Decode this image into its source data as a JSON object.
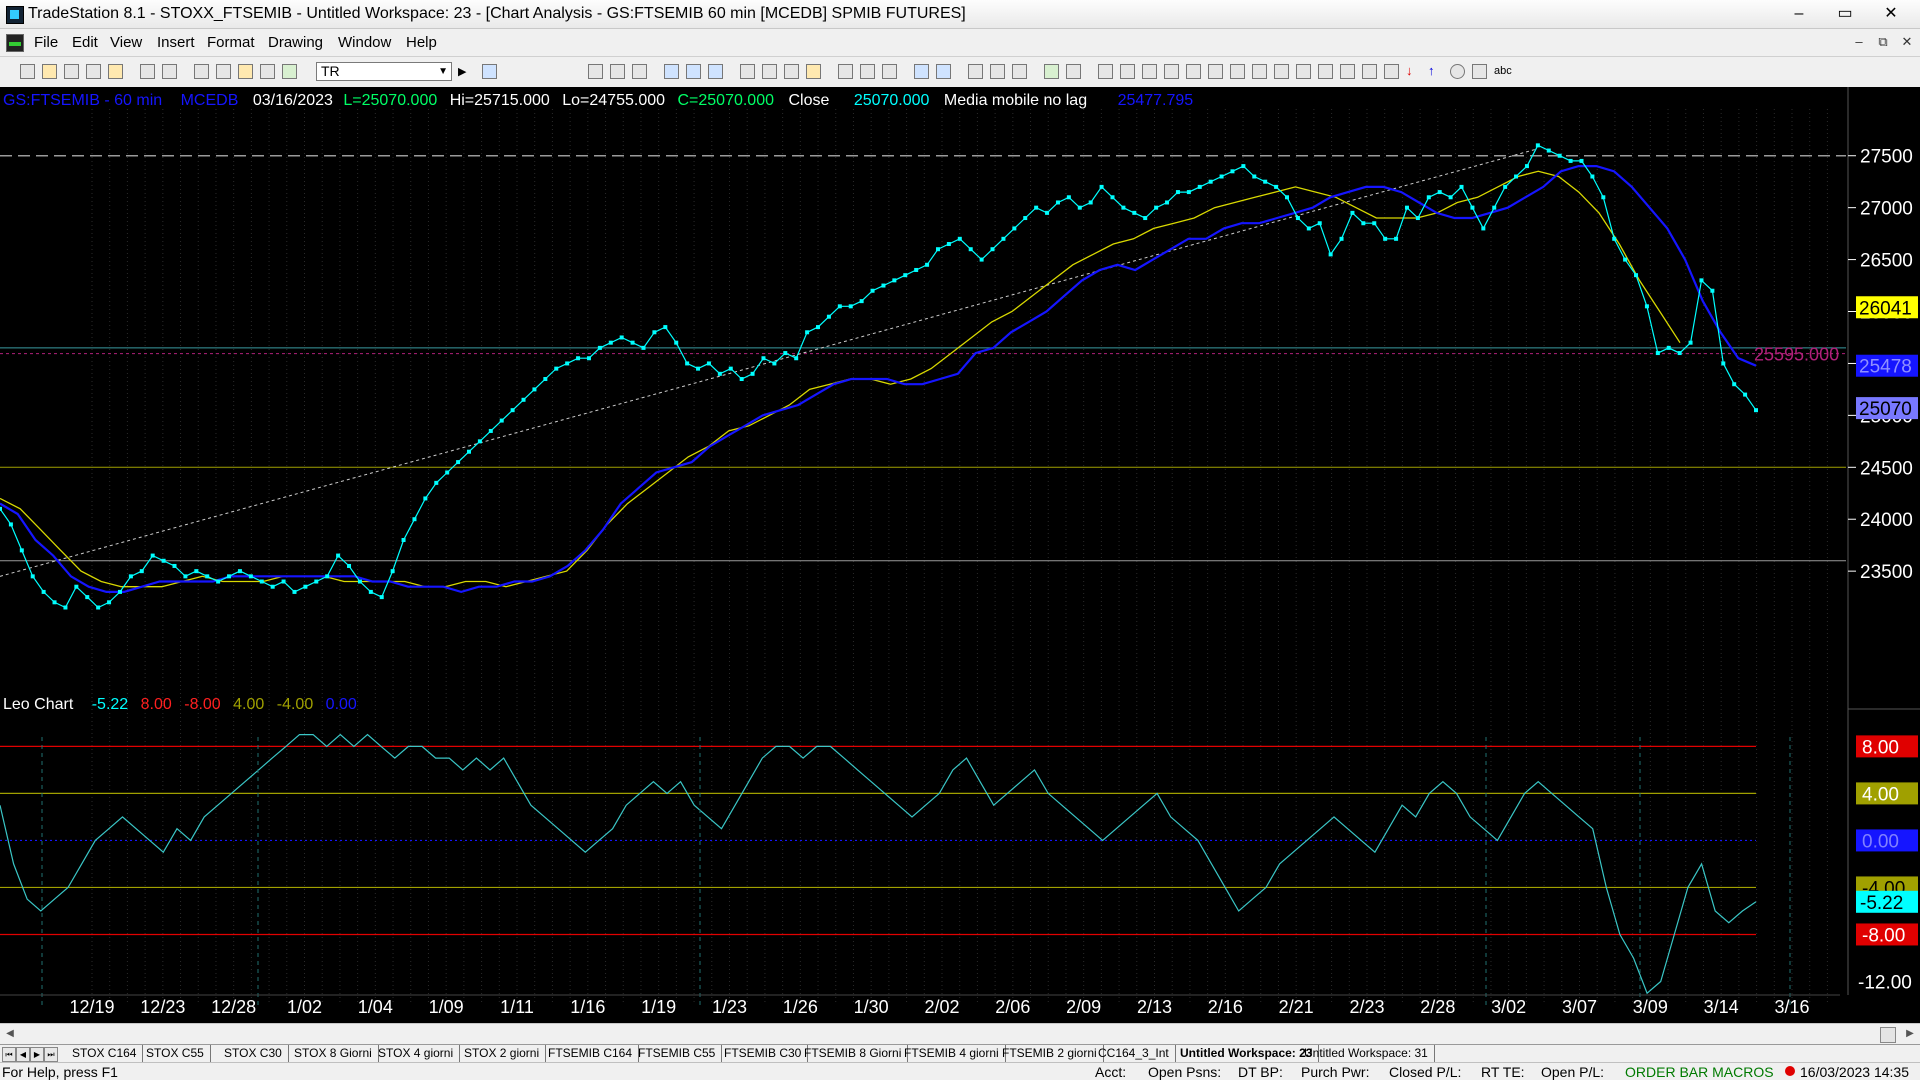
{
  "window": {
    "title": "TradeStation 8.1 - STOXX_FTSEMIB - Untitled Workspace:  23 - [Chart Analysis - GS:FTSEMIB  60 min  [MCEDB] SPMIB FUTURES]",
    "minimize": "–",
    "maximize": "▭",
    "close": "✕"
  },
  "menu": {
    "items": [
      "File",
      "Edit",
      "View",
      "Insert",
      "Format",
      "Drawing",
      "Window",
      "Help"
    ],
    "mdi_min": "–",
    "mdi_restore": "⧉",
    "mdi_close": "✕"
  },
  "toolbar": {
    "symbol_value": "TR",
    "tool_text": "abc"
  },
  "price_header": {
    "symbol": "GS:FTSEMIB - 60 min",
    "feed": "MCEDB",
    "date": "03/16/2023",
    "low_label": "L=25070.000",
    "high_label": "Hi=25715.000",
    "lo_label": "Lo=24755.000",
    "close_label": "C=25070.000",
    "close_word": "Close",
    "close_value": "25070.000",
    "indicator_name": "Media mobile no lag",
    "indicator_value": "25477.795"
  },
  "osc_header": {
    "name": "Leo Chart",
    "values": [
      "-5.22",
      "8.00",
      "-8.00",
      "4.00",
      "-4.00",
      "0.00"
    ]
  },
  "colors": {
    "price": "#00ffff",
    "ma_blue": "#1515ff",
    "ma_yellow": "#d8d800",
    "red": "#e00000",
    "olive": "#a0a000",
    "teal": "#3a9aa0",
    "magenta": "#b0207a"
  },
  "chart_data": [
    {
      "type": "line",
      "x_ticks": [
        "12/19",
        "12/23",
        "12/28",
        "1/02",
        "1/04",
        "1/09",
        "1/11",
        "1/16",
        "1/19",
        "1/23",
        "1/26",
        "1/30",
        "2/02",
        "2/06",
        "2/09",
        "2/13",
        "2/16",
        "2/21",
        "2/23",
        "2/28",
        "3/02",
        "3/07",
        "3/09",
        "3/14",
        "3/16"
      ],
      "y_ticks": [
        23500,
        24000,
        24500,
        25000,
        25500,
        26000,
        26500,
        27000,
        27500
      ],
      "ylim": [
        22500,
        27950
      ],
      "series": [
        {
          "name": "GS:FTSEMIB - 60 min",
          "values": [
            24100,
            23950,
            23700,
            23450,
            23300,
            23200,
            23150,
            23350,
            23250,
            23150,
            23200,
            23300,
            23450,
            23500,
            23650,
            23600,
            23550,
            23450,
            23500,
            23450,
            23400,
            23450,
            23500,
            23450,
            23400,
            23350,
            23400,
            23300,
            23350,
            23400,
            23450,
            23650,
            23550,
            23400,
            23300,
            23250,
            23500,
            23800,
            24000,
            24200,
            24350,
            24450,
            24550,
            24650,
            24750,
            24850,
            24950,
            25050,
            25150,
            25250,
            25350,
            25450,
            25500,
            25550,
            25550,
            25650,
            25700,
            25750,
            25700,
            25650,
            25800,
            25850,
            25700,
            25500,
            25450,
            25500,
            25400,
            25450,
            25350,
            25400,
            25550,
            25500,
            25600,
            25550,
            25800,
            25850,
            25950,
            26050,
            26050,
            26100,
            26200,
            26250,
            26300,
            26350,
            26400,
            26450,
            26600,
            26650,
            26700,
            26600,
            26500,
            26600,
            26700,
            26800,
            26900,
            27000,
            26950,
            27050,
            27100,
            27000,
            27050,
            27200,
            27100,
            27000,
            26950,
            26900,
            27000,
            27050,
            27150,
            27150,
            27200,
            27250,
            27300,
            27350,
            27400,
            27300,
            27250,
            27200,
            27100,
            26900,
            26800,
            26850,
            26550,
            26700,
            26950,
            26850,
            26850,
            26700,
            26700,
            27000,
            26900,
            27100,
            27150,
            27100,
            27200,
            27000,
            26800,
            27000,
            27200,
            27300,
            27400,
            27600,
            27550,
            27500,
            27450,
            27450,
            27300,
            27100,
            26700,
            26500,
            26350,
            26050,
            25600,
            25650,
            25600,
            25700,
            26300,
            26200,
            25500,
            25300,
            25200,
            25050
          ]
        },
        {
          "name": "Media mobile no lag",
          "values": [
            24150,
            24050,
            23800,
            23650,
            23450,
            23350,
            23300,
            23300,
            23350,
            23400,
            23400,
            23400,
            23400,
            23450,
            23450,
            23450,
            23450,
            23450,
            23450,
            23450,
            23450,
            23400,
            23400,
            23350,
            23350,
            23350,
            23300,
            23350,
            23350,
            23400,
            23400,
            23450,
            23550,
            23700,
            23900,
            24150,
            24300,
            24450,
            24500,
            24550,
            24700,
            24800,
            24900,
            25000,
            25050,
            25100,
            25200,
            25300,
            25350,
            25350,
            25350,
            25300,
            25300,
            25350,
            25400,
            25600,
            25650,
            25800,
            25900,
            26000,
            26150,
            26300,
            26400,
            26450,
            26400,
            26500,
            26600,
            26700,
            26700,
            26800,
            26850,
            26850,
            26900,
            26950,
            27000,
            27100,
            27150,
            27200,
            27200,
            27150,
            27050,
            26950,
            26900,
            26900,
            26950,
            27000,
            27100,
            27200,
            27350,
            27400,
            27400,
            27350,
            27200,
            27000,
            26800,
            26500,
            26100,
            25800,
            25550,
            25477.795
          ]
        },
        {
          "name": "",
          "values": [
            24200,
            24100,
            23900,
            23700,
            23500,
            23400,
            23350,
            23350,
            23350,
            23400,
            23450,
            23400,
            23400,
            23400,
            23450,
            23450,
            23450,
            23400,
            23400,
            23400,
            23400,
            23350,
            23350,
            23400,
            23400,
            23350,
            23400,
            23450,
            23500,
            23700,
            23950,
            24150,
            24300,
            24450,
            24600,
            24700,
            24850,
            24900,
            25000,
            25100,
            25250,
            25300,
            25350,
            25350,
            25300,
            25350,
            25450,
            25600,
            25750,
            25900,
            26000,
            26150,
            26300,
            26450,
            26550,
            26650,
            26700,
            26800,
            26850,
            26900,
            27000,
            27050,
            27100,
            27150,
            27200,
            27150,
            27100,
            27000,
            26900,
            26900,
            26900,
            26950,
            27050,
            27100,
            27200,
            27300,
            27350,
            27300,
            27150,
            26950,
            26650,
            26300,
            26000,
            25700
          ]
        }
      ],
      "horizontal_lines": [
        27500,
        25595,
        24500,
        23600
      ],
      "annotations": [
        "25595.000"
      ],
      "price_markers": [
        "26041",
        "25478",
        "25070"
      ]
    },
    {
      "type": "line",
      "ylim": [
        -14.0,
        10.5
      ],
      "y_ticks": [
        8.0,
        4.0,
        0.0,
        -4.0,
        -8.0,
        -12.0
      ],
      "y_tick_labels": [
        "8.00",
        "4.00",
        "0.00",
        "-4.00",
        "-8.00",
        "-12.00",
        "-5.22"
      ],
      "series": [
        {
          "name": "Leo Chart",
          "values": [
            3,
            -2,
            -5,
            -6,
            -5,
            -4,
            -2,
            0,
            1,
            2,
            1,
            0,
            -1,
            1,
            0,
            2,
            3,
            4,
            5,
            6,
            7,
            8,
            9,
            9,
            8,
            9,
            8,
            9,
            8,
            7,
            8,
            8,
            7,
            7,
            6,
            7,
            6,
            7,
            5,
            3,
            2,
            1,
            0,
            -1,
            0,
            1,
            3,
            4,
            5,
            4,
            5,
            3,
            2,
            1,
            3,
            5,
            7,
            8,
            8,
            7,
            8,
            8,
            7,
            6,
            5,
            4,
            3,
            2,
            3,
            4,
            6,
            7,
            5,
            3,
            4,
            5,
            6,
            4,
            3,
            2,
            1,
            0,
            1,
            2,
            3,
            4,
            2,
            1,
            0,
            -2,
            -4,
            -6,
            -5,
            -4,
            -2,
            -1,
            0,
            1,
            2,
            1,
            0,
            -1,
            1,
            3,
            2,
            4,
            5,
            4,
            2,
            1,
            0,
            2,
            4,
            5,
            4,
            3,
            2,
            1,
            -4,
            -8,
            -10,
            -13,
            -12,
            -8,
            -4,
            -2,
            -6,
            -7,
            -6,
            -5.22
          ]
        }
      ],
      "horizontal_lines": [
        8.0,
        4.0,
        0.0,
        -4.0,
        -8.0
      ]
    }
  ],
  "tabs": {
    "items": [
      "STOX C164",
      "STOX C55",
      "STOX  C30",
      "STOX  8 Giorni",
      "STOX 4 giorni",
      "STOX  2 giorni",
      "FTSEMIB C164",
      "FTSEMIB C55",
      "FTSEMIB C30",
      "FTSEMIB  8 Giorni",
      "FTSEMIB  4 giorni",
      "FTSEMIB  2 giorni",
      "CC164_3_Int",
      "Untitled Workspace:  23",
      "Untitled Workspace:  31"
    ],
    "active_index": 13
  },
  "status": {
    "help": "For Help, press F1",
    "acct": "Acct:",
    "open_psns": "Open Psns:",
    "dt_bp": "DT BP:",
    "purch_pwr": "Purch Pwr:",
    "closed_pl": "Closed P/L:",
    "rt_te": "RT TE:",
    "open_pl": "Open P/L:",
    "order_bar": "ORDER BAR  MACROS",
    "datetime": "16/03/2023 14:35"
  }
}
